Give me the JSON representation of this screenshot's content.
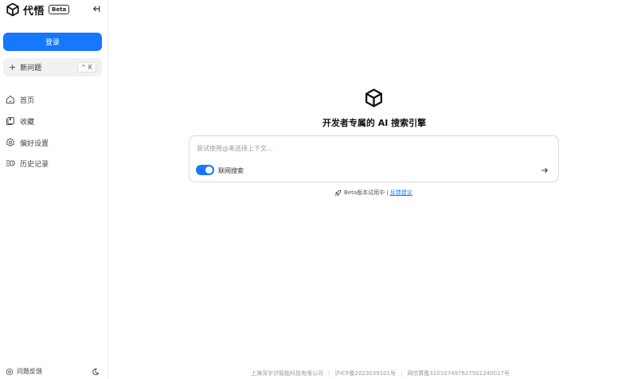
{
  "app": {
    "name": "代悟",
    "badge": "Beta"
  },
  "sidebar": {
    "login_label": "登录",
    "new_label": "新问题",
    "new_shortcut": "^ K",
    "items": [
      {
        "label": "首页",
        "icon": "home-icon"
      },
      {
        "label": "收藏",
        "icon": "bookmark-icon"
      },
      {
        "label": "偏好设置",
        "icon": "gear-icon"
      },
      {
        "label": "历史记录",
        "icon": "history-icon"
      }
    ],
    "feedback_label": "问题反馈"
  },
  "main": {
    "title": "开发者专属的 AI 搜索引擎",
    "search_placeholder": "尝试使用@来选择上下文...",
    "web_search_label": "联网搜索",
    "web_search_on": true,
    "beta_text": "Beta版本试用中 |",
    "feedback_link": "反馈建议"
  },
  "footer": {
    "company": "上海深宇识智能科技有限公司",
    "icp": "沪ICP备2023039101号",
    "algorithm": "网信算备310107497627501240017号"
  },
  "colors": {
    "accent": "#1677ff",
    "new_button_bg": "#f1f1f1"
  }
}
